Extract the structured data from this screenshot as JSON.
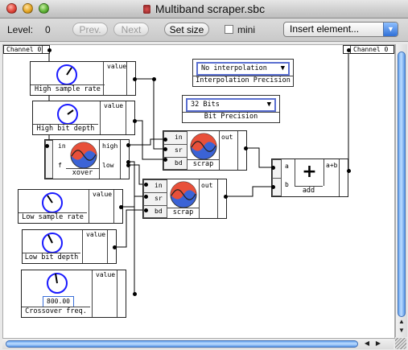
{
  "window": {
    "title": "Multiband scraper.sbc"
  },
  "toolbar": {
    "level_label": "Level:",
    "level_value": "0",
    "prev_label": "Prev.",
    "next_label": "Next",
    "set_size_label": "Set size",
    "mini_label": "mini",
    "insert_label": "Insert element..."
  },
  "channels": {
    "left": "Channel 0",
    "right": "Channel 0"
  },
  "controls": {
    "interpolation": {
      "value": "No interpolation",
      "caption": "Interpolation Precision"
    },
    "bits": {
      "value": "32 Bits",
      "caption": "Bit Precision"
    }
  },
  "modules": {
    "high_rate": {
      "caption": "High sample rate",
      "port": "value"
    },
    "high_bits": {
      "caption": "High bit depth",
      "port": "value"
    },
    "xover": {
      "caption": "xover",
      "in": "in",
      "f": "f",
      "high": "high",
      "low": "low"
    },
    "scrap_top": {
      "caption": "scrap",
      "in": "in",
      "sr": "sr",
      "bd": "bd",
      "out": "out"
    },
    "scrap_bottom": {
      "caption": "scrap",
      "in": "in",
      "sr": "sr",
      "bd": "bd",
      "out": "out"
    },
    "add": {
      "caption": "add",
      "a": "a",
      "b": "b",
      "out": "a+b",
      "symbol": "+"
    },
    "low_rate": {
      "caption": "Low sample rate",
      "port": "value"
    },
    "low_bits": {
      "caption": "Low bit depth",
      "port": "value"
    },
    "crossover": {
      "caption": "Crossover freq.",
      "port": "value",
      "display": "800.00"
    }
  },
  "colors": {
    "accent": "#3b6fd8",
    "knob": "#1a1aff",
    "wave_red": "#e8503a",
    "wave_blue": "#3b63d6"
  }
}
